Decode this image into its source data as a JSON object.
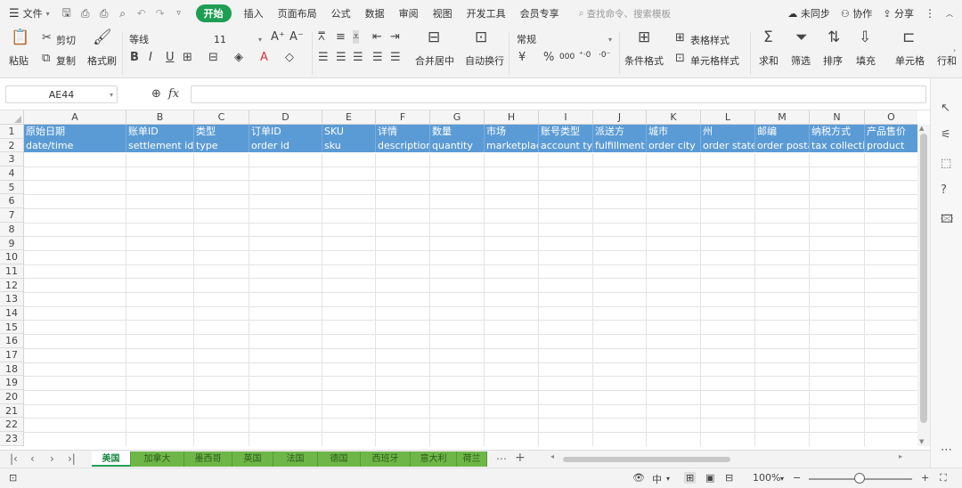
{
  "menu": {
    "file_label": "文件",
    "tabs": [
      {
        "label": "开始",
        "active": true
      },
      {
        "label": "插入"
      },
      {
        "label": "页面布局"
      },
      {
        "label": "公式"
      },
      {
        "label": "数据"
      },
      {
        "label": "审阅"
      },
      {
        "label": "视图"
      },
      {
        "label": "开发工具"
      },
      {
        "label": "会员专享"
      }
    ],
    "search_placeholder": "查找命令、搜索模板",
    "sync_label": "未同步",
    "collab_label": "协作",
    "share_label": "分享"
  },
  "ribbon": {
    "paste_label": "粘贴",
    "cut_label": "剪切",
    "copy_label": "复制",
    "format_painter_label": "格式刷",
    "font_name": "等线",
    "font_size": "11",
    "number_format": "常规",
    "merge_label": "合并居中",
    "wrap_label": "自动换行",
    "currency_label": "¥",
    "percent_label": "%",
    "thousands_label": "000",
    "cond_format_label": "条件格式",
    "table_style_label": "表格样式",
    "cell_style_label": "单元格样式",
    "sum_label": "求和",
    "filter_label": "筛选",
    "sort_label": "排序",
    "fill_label": "填充",
    "cell_label": "单元格",
    "rowcol_label": "行和"
  },
  "formula_bar": {
    "cell_ref": "AE44",
    "fx_label": "fx",
    "formula": ""
  },
  "grid": {
    "columns": [
      "A",
      "B",
      "C",
      "D",
      "E",
      "F",
      "G",
      "H",
      "I",
      "J",
      "K",
      "L",
      "M",
      "N",
      "O"
    ],
    "row_numbers": [
      "1",
      "2",
      "3",
      "4",
      "5",
      "6",
      "7",
      "8",
      "9",
      "10",
      "11",
      "12",
      "13",
      "14",
      "15",
      "16",
      "17",
      "18",
      "19",
      "20",
      "21",
      "22",
      "23"
    ],
    "header_row_cn": [
      "原始日期",
      "账单ID",
      "类型",
      "订单ID",
      "SKU",
      "详情",
      "数量",
      "市场",
      "账号类型",
      "派送方",
      "城市",
      "州",
      "邮编",
      "纳税方式",
      "产品售价"
    ],
    "header_row_en": [
      "date/time",
      "settlement id",
      "type",
      "order id",
      "sku",
      "description",
      "quantity",
      "marketplace",
      "account type",
      "fulfillment",
      "order city",
      "order state",
      "order postal",
      "tax collection",
      "product"
    ]
  },
  "sheets": [
    {
      "label": "美国",
      "active": true
    },
    {
      "label": "加拿大"
    },
    {
      "label": "墨西哥"
    },
    {
      "label": "英国"
    },
    {
      "label": "法国"
    },
    {
      "label": "德国"
    },
    {
      "label": "西班牙"
    },
    {
      "label": "意大利"
    },
    {
      "label": "荷兰"
    }
  ],
  "status": {
    "zoom": "100%",
    "ime_label": "中"
  }
}
